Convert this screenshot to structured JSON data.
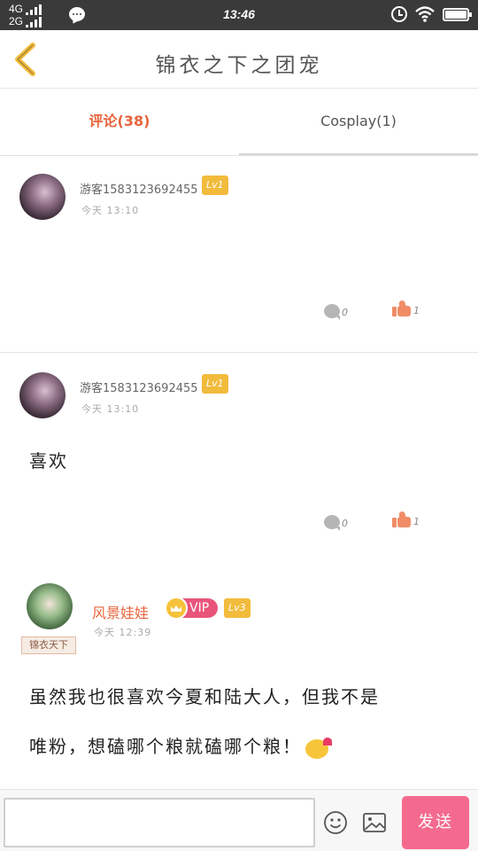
{
  "status_bar": {
    "network_top": "4G",
    "network_bottom": "2G",
    "time": "13:46"
  },
  "header": {
    "title": "锦衣之下之团宠",
    "back_icon": "chevron-left-icon",
    "back_color": "#f2bb3c"
  },
  "tabs": [
    {
      "label": "评论(38)",
      "active": true
    },
    {
      "label": "Cosplay(1)",
      "active": false
    }
  ],
  "comments": [
    {
      "username": "游客15831236924​55",
      "level": "Lv1",
      "time": "今天  13:10",
      "text": "",
      "reply_count": "0",
      "like_count": "1"
    },
    {
      "username": "游客15831236924​55",
      "level": "Lv1",
      "time": "今天  13:10",
      "text": "喜欢",
      "reply_count": "0",
      "like_count": "1"
    },
    {
      "username": "风景娃娃",
      "vip": "VIP",
      "level": "Lv3",
      "badge": "锦衣天下",
      "time": "今天  12:39",
      "text_line1": "虽然我也很喜欢今夏和陆大人，但我不是",
      "text_line2": "唯粉，想磕哪个粮就磕哪个粮！"
    }
  ],
  "input_bar": {
    "placeholder": "",
    "emoji_icon": "smiley-icon",
    "image_icon": "image-icon",
    "send_label": "发送"
  },
  "colors": {
    "accent": "#e8643c",
    "level_badge": "#f2bb3c",
    "vip": "#e9557a",
    "send": "#f46a8e",
    "like": "#f08d67"
  }
}
